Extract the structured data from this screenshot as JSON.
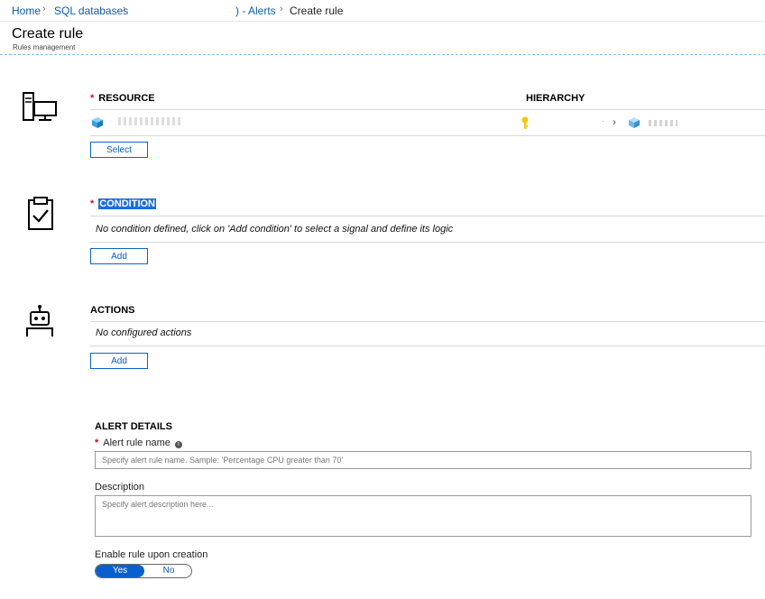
{
  "breadcrumb": {
    "home": "Home",
    "sql_databases": "SQL databases",
    "alerts": ") - Alerts",
    "current": "Create rule"
  },
  "header": {
    "title": "Create rule",
    "subtitle": "Rules management"
  },
  "resource": {
    "label": "RESOURCE",
    "hierarchy_label": "HIERARCHY",
    "resource_name": "",
    "select_label": "Select"
  },
  "condition": {
    "label": "CONDITION",
    "empty_text": "No condition defined, click on 'Add condition' to select a signal and define its logic",
    "add_label": "Add"
  },
  "actions": {
    "label": "ACTIONS",
    "empty_text": "No configured actions",
    "add_label": "Add"
  },
  "alert_details": {
    "heading": "ALERT DETAILS",
    "rule_name_label": "Alert rule name",
    "rule_name_placeholder": "Specify alert rule name. Sample: 'Percentage CPU greater than 70'",
    "description_label": "Description",
    "description_placeholder": "Specify alert description here...",
    "enable_label": "Enable rule upon creation",
    "toggle_yes": "Yes",
    "toggle_no": "No",
    "enabled_selected": "Yes"
  },
  "colors": {
    "link": "#0b5cab",
    "accent": "#0a5fd0",
    "required": "#c50f1f",
    "key": "#f2c811"
  },
  "icons": {
    "resource": "computer-icon",
    "condition": "clipboard-check-icon",
    "actions": "robot-icon",
    "resource_cube": "cube-icon",
    "hierarchy_key": "key-icon",
    "info": "info-icon"
  }
}
